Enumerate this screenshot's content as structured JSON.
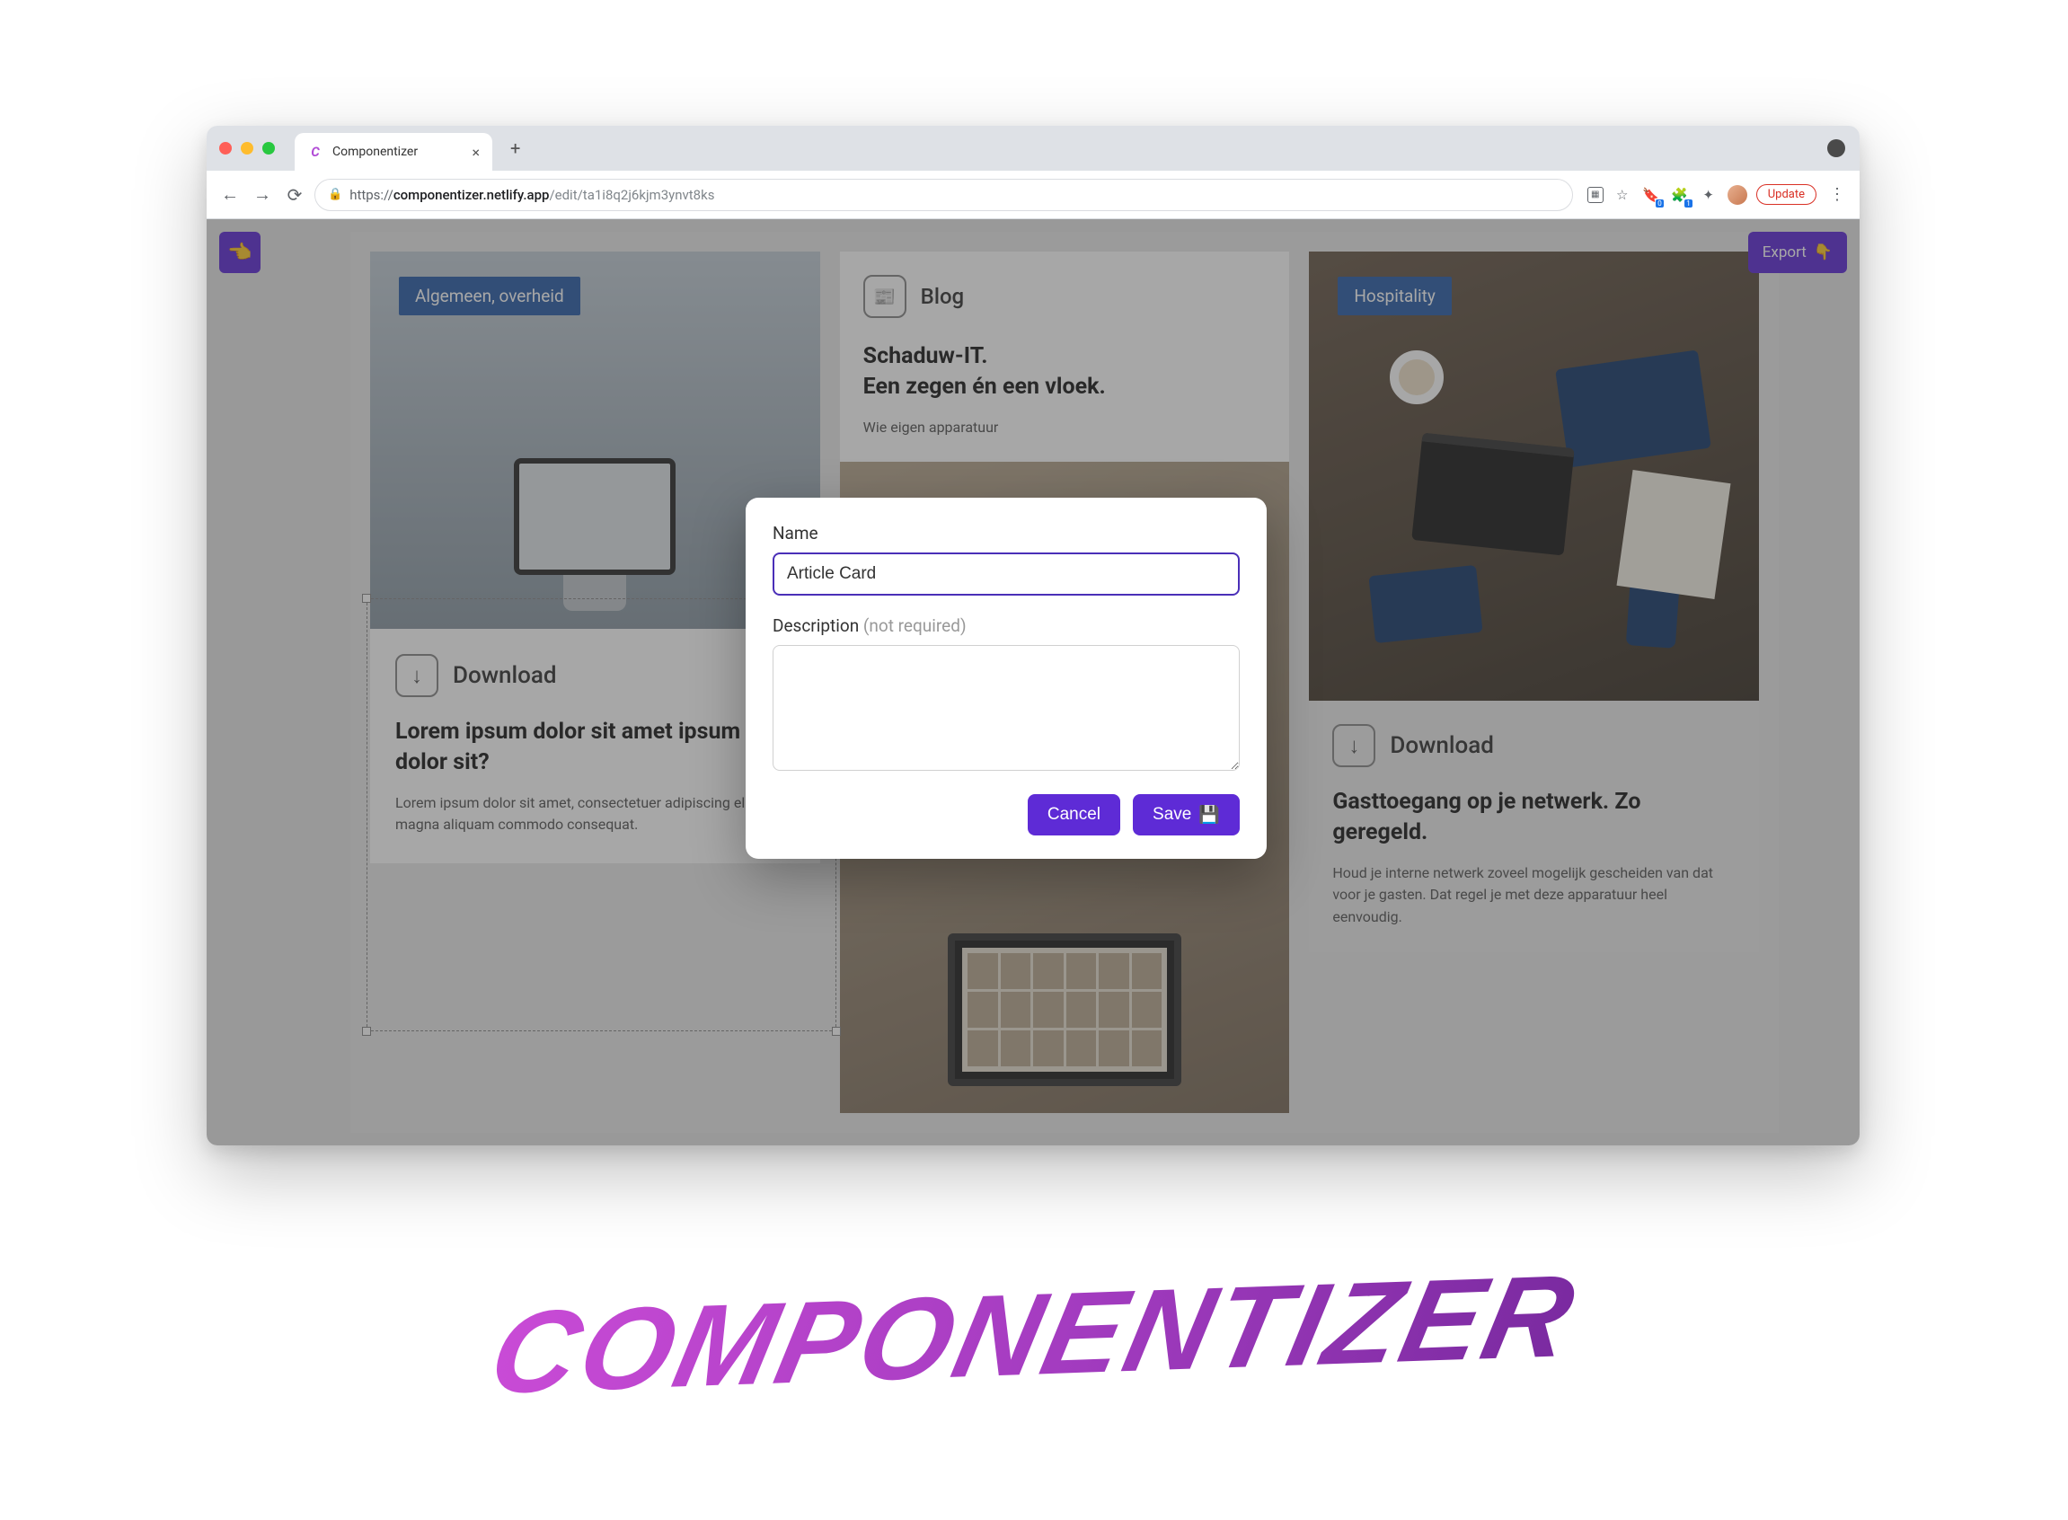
{
  "browser": {
    "tab_title": "Componentizer",
    "url_display": {
      "proto": "https://",
      "host": "componentizer.netlify.app",
      "path": "/edit/ta1i8q2j6kjm3ynvt8ks"
    },
    "update_label": "Update"
  },
  "app": {
    "export_label": "Export",
    "canvas": {
      "col1": {
        "tag": "Algemeen, overheid",
        "download_label": "Download",
        "title": "Lorem ipsum dolor sit amet ipsum dolor sit?",
        "text": "Lorem ipsum dolor sit amet, consectetuer adipiscing elit,re magna aliquam commodo consequat."
      },
      "col2": {
        "blog_label": "Blog",
        "title": "Schaduw-IT.\nEen zegen én een vloek.",
        "text": "Wie eigen apparatuur"
      },
      "col3": {
        "tag": "Hospitality",
        "download_label": "Download",
        "title": "Gasttoegang op je netwerk. Zo geregeld.",
        "text": "Houd je interne netwerk zoveel mogelijk gescheiden van dat voor je gasten. Dat regel je met deze apparatuur heel eenvoudig."
      }
    }
  },
  "modal": {
    "name_label": "Name",
    "name_value": "Article Card",
    "desc_label": "Description",
    "desc_hint": "(not required)",
    "cancel": "Cancel",
    "save": "Save"
  },
  "wordmark": "COMPONENTIZER"
}
